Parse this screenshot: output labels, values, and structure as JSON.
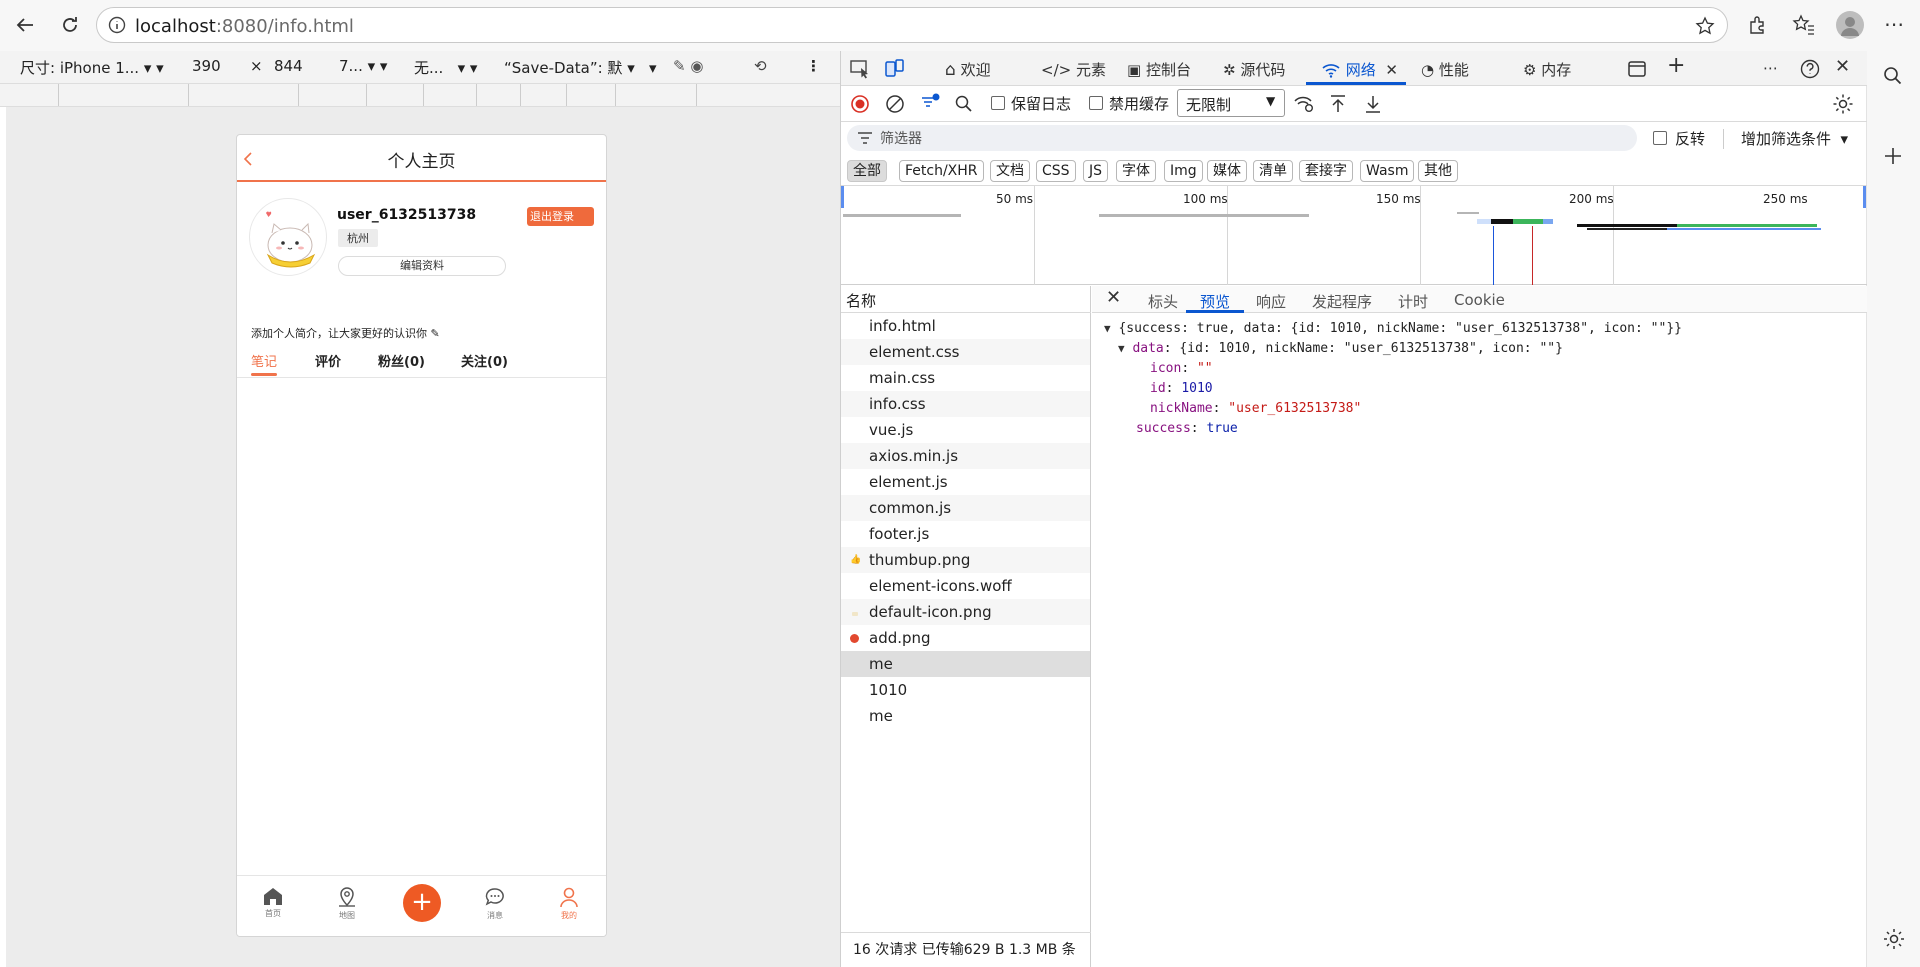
{
  "browser": {
    "url_host": "localhost",
    "url_rest": ":8080/info.html"
  },
  "device_toolbar": {
    "dimensions_label": "尺寸: iPhone 1...",
    "width": "390",
    "times": "×",
    "height": "844",
    "zoom": "7...",
    "throttle": "无...",
    "save_data": "“Save-Data”: 默"
  },
  "phone": {
    "title": "个人主页",
    "username": "user_6132513738",
    "city": "杭州",
    "logout": "退出登录",
    "edit_profile": "编辑资料",
    "intro": "添加个人简介，让大家更好的认识你 ✎",
    "tabs": [
      "笔记",
      "评价",
      "粉丝(0)",
      "关注(0)"
    ],
    "footer": [
      "首页",
      "地图",
      "消息",
      "我的"
    ],
    "add_symbol": "+"
  },
  "devtools": {
    "tabs": [
      "欢迎",
      "元素",
      "控制台",
      "源代码",
      "网络",
      "性能",
      "内存"
    ],
    "toolbar": {
      "preserve_log": "保留日志",
      "disable_cache": "禁用缓存",
      "throttling": "无限制"
    },
    "filter": {
      "placeholder": "筛选器",
      "invert": "反转",
      "more_filters": "增加筛选条件"
    },
    "type_filters": [
      "全部",
      "Fetch/XHR",
      "文档",
      "CSS",
      "JS",
      "字体",
      "Img",
      "媒体",
      "清单",
      "套接字",
      "Wasm",
      "其他"
    ],
    "timeline_labels": [
      "50 ms",
      "100 ms",
      "150 ms",
      "200 ms",
      "250 ms"
    ],
    "requests_header": "名称",
    "requests": [
      "info.html",
      "element.css",
      "main.css",
      "info.css",
      "vue.js",
      "axios.min.js",
      "element.js",
      "common.js",
      "footer.js",
      "thumbup.png",
      "element-icons.woff",
      "default-icon.png",
      "add.png",
      "me",
      "1010",
      "me"
    ],
    "selected_request": "me",
    "status": "16 次请求   已传输629 B   1.3 MB 条",
    "detail_tabs": [
      "标头",
      "预览",
      "响应",
      "发起程序",
      "计时",
      "Cookie"
    ],
    "preview": {
      "summary": "{success: true, data: {id: 1010, nickName: \"user_6132513738\", icon: \"\"}}",
      "data_summary": "{id: 1010, nickName: \"user_6132513738\", icon: \"\"}",
      "icon_value": "\"\"",
      "id_value": "1010",
      "nickname_value": "\"user_6132513738\"",
      "success_value": "true"
    }
  },
  "colors": {
    "accent_orange": "#ef6a3c",
    "devtools_blue": "#0b57d0"
  }
}
